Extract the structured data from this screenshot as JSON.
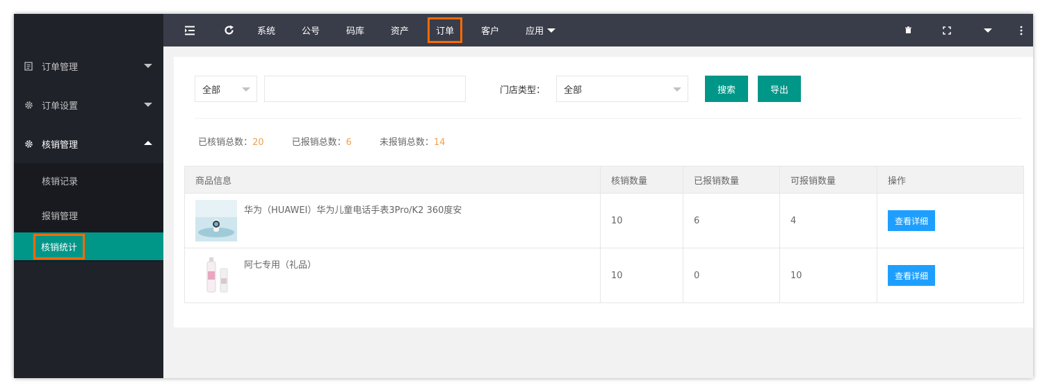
{
  "sidebar": {
    "groups": [
      {
        "label": "订单管理",
        "icon": "document-icon"
      },
      {
        "label": "订单设置",
        "icon": "gear-icon"
      },
      {
        "label": "核销管理",
        "icon": "gear-icon"
      }
    ],
    "submenu": [
      {
        "label": "核销记录"
      },
      {
        "label": "报销管理"
      },
      {
        "label": "核销统计"
      }
    ]
  },
  "header": {
    "nav": [
      "系统",
      "公号",
      "码库",
      "资产",
      "订单",
      "客户",
      "应用"
    ],
    "icons": [
      "menu-fold-icon",
      "refresh-icon",
      "trash-icon",
      "fullscreen-icon",
      "dropdown-icon",
      "more-icon"
    ]
  },
  "filter": {
    "scope_select": "全部",
    "keyword_value": "",
    "store_type_label": "门店类型：",
    "store_type_select": "全部",
    "search_button": "搜索",
    "export_button": "导出"
  },
  "stats": {
    "verified_label": "已核销总数：",
    "verified_value": "20",
    "reimbursed_label": "已报销总数：",
    "reimbursed_value": "6",
    "unreimbursed_label": "未报销总数：",
    "unreimbursed_value": "14"
  },
  "table": {
    "headers": [
      "商品信息",
      "核销数量",
      "已报销数量",
      "可报销数量",
      "操作"
    ],
    "rows": [
      {
        "product": "华为（HUAWEI）华为儿童电话手表3Pro/K2 360度安",
        "verified": "10",
        "reimbursed": "6",
        "available": "4",
        "action": "查看详细"
      },
      {
        "product": "阿七专用（礼品）",
        "verified": "10",
        "reimbursed": "0",
        "available": "10",
        "action": "查看详细"
      }
    ]
  },
  "colors": {
    "accent": "#009688",
    "highlight": "#ff6a00",
    "detail_button": "#1e9fff",
    "stat_number": "#f0a050"
  }
}
